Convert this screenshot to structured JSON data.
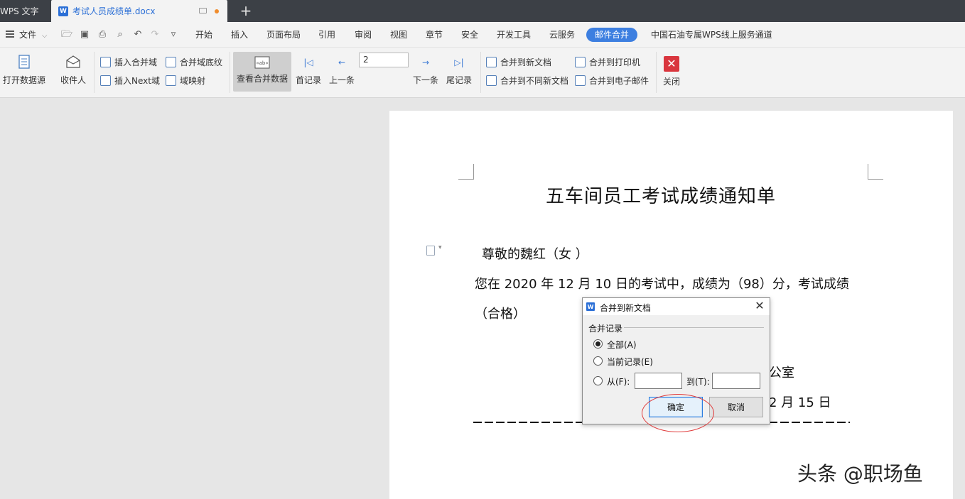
{
  "titlebar": {
    "app_tab": "WPS 文字",
    "doc_tab": "考试人员成绩单.docx",
    "new_tab": "+"
  },
  "menubar": {
    "file": "文件",
    "items": [
      "开始",
      "插入",
      "页面布局",
      "引用",
      "审阅",
      "视图",
      "章节",
      "安全",
      "开发工具",
      "云服务",
      "邮件合并",
      "中国石油专属WPS线上服务通道"
    ],
    "active": "邮件合并"
  },
  "ribbon": {
    "open_source": "打开数据源",
    "recipients": "收件人",
    "insert_merge_field": "插入合并域",
    "insert_next": "插入Next域",
    "merge_field_shading": "合并域底纹",
    "field_mapping": "域映射",
    "view_merged_data": "查看合并数据",
    "first_record": "首记录",
    "prev_record": "上一条",
    "record_number": "2",
    "next_record": "下一条",
    "last_record": "尾记录",
    "merge_new_doc": "合并到新文档",
    "merge_diff_docs": "合并到不同新文档",
    "merge_printer": "合并到打印机",
    "merge_email": "合并到电子邮件",
    "close": "关闭"
  },
  "document": {
    "title": "五车间员工考试成绩通知单",
    "greeting": "尊敬的魏红（女   ）",
    "line1": "您在 2020 年 12 月 10 日的考试中，成绩为（98）分，考试成绩",
    "line2": "（合格）",
    "line3_visible": "公室",
    "line4_visible": "2 月 15 日"
  },
  "dialog": {
    "title": "合并到新文档",
    "group_label": "合并记录",
    "option_all": "全部(A)",
    "option_current": "当前记录(E)",
    "option_from": "从(F):",
    "option_to": "到(T):",
    "ok": "确定",
    "cancel": "取消"
  },
  "watermark": "头条 @职场鱼"
}
